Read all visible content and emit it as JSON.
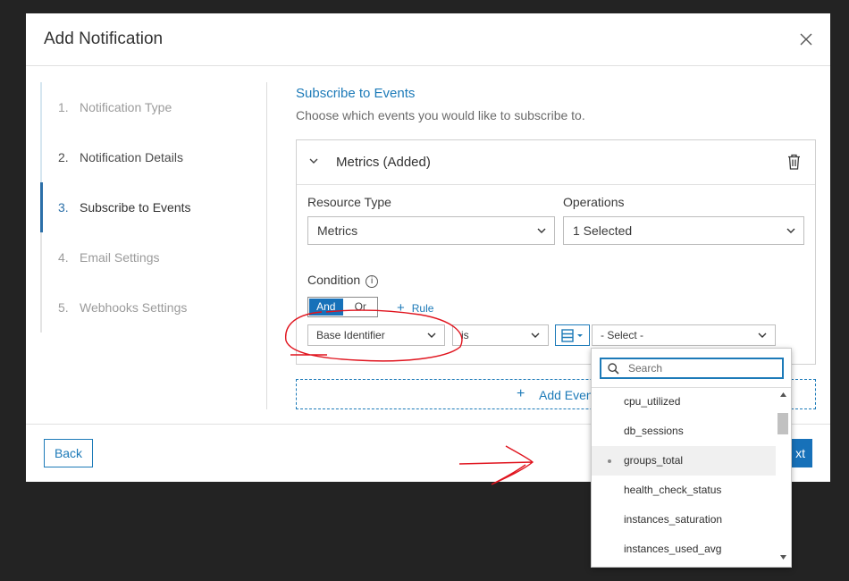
{
  "dialog": {
    "title": "Add Notification"
  },
  "steps": [
    {
      "num": "1.",
      "label": "Notification Type"
    },
    {
      "num": "2.",
      "label": "Notification Details"
    },
    {
      "num": "3.",
      "label": "Subscribe to Events"
    },
    {
      "num": "4.",
      "label": "Email Settings"
    },
    {
      "num": "5.",
      "label": "Webhooks Settings"
    }
  ],
  "section": {
    "title": "Subscribe to Events",
    "subtitle": "Choose which events you would like to subscribe to."
  },
  "card": {
    "title": "Metrics (Added)",
    "resource_type_label": "Resource Type",
    "resource_type_value": "Metrics",
    "operations_label": "Operations",
    "operations_value": "1 Selected",
    "condition_label": "Condition",
    "toggle_and": "And",
    "toggle_or": "Or",
    "add_rule": "Rule",
    "rule": {
      "field": "Base Identifier",
      "operator": "is",
      "value": "- Select -"
    }
  },
  "add_event_label": "Add Even",
  "footer": {
    "back": "Back",
    "next": "xt"
  },
  "dropdown": {
    "search_placeholder": "Search",
    "items": [
      "cpu_utilized",
      "db_sessions",
      "groups_total",
      "health_check_status",
      "instances_saturation",
      "instances_used_avg"
    ],
    "highlighted": "groups_total"
  },
  "colors": {
    "accent": "#1c7ab8",
    "primary_button": "#1771b9",
    "annotation": "#e0141e",
    "backdrop": "#232323"
  }
}
